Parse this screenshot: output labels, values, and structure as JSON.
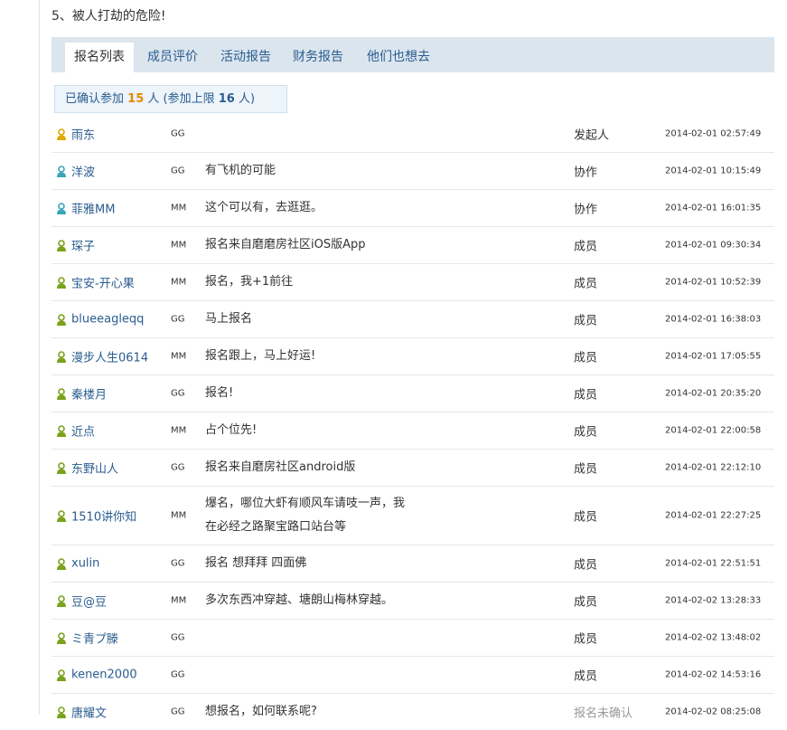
{
  "notice": "5、被人打劫的危险!",
  "tabs": [
    "报名列表",
    "成员评价",
    "活动报告",
    "财务报告",
    "他们也想去"
  ],
  "summary": {
    "prefix": "已确认参加",
    "confirmed": "15",
    "mid": "人 (参加上限",
    "limit": "16",
    "suffix": "人)"
  },
  "colors": {
    "organizer": "#e0a800",
    "helper": "#3aa6b8",
    "member": "#7aa21c",
    "link": "#2a5d8f"
  },
  "participants": [
    {
      "name": "雨东",
      "icon": "organizer-user-icon",
      "gender": "GG",
      "comment": "",
      "role": "发起人",
      "time": "2014-02-01 02:57:49"
    },
    {
      "name": "洋波",
      "icon": "helper-user-icon",
      "gender": "GG",
      "comment": "有飞机的可能",
      "role": "协作",
      "time": "2014-02-01 10:15:49"
    },
    {
      "name": "菲雅MM",
      "icon": "helper-user-icon",
      "gender": "MM",
      "comment": "这个可以有，去逛逛。",
      "role": "协作",
      "time": "2014-02-01 16:01:35"
    },
    {
      "name": "琛子",
      "icon": "member-user-icon",
      "gender": "MM",
      "comment": "报名来自磨磨房社区iOS版App",
      "role": "成员",
      "time": "2014-02-01 09:30:34"
    },
    {
      "name": "宝安-开心果",
      "icon": "member-user-icon",
      "gender": "MM",
      "comment": "报名，我+1前往",
      "role": "成员",
      "time": "2014-02-01 10:52:39"
    },
    {
      "name": "blueeagleqq",
      "icon": "member-user-icon",
      "gender": "GG",
      "comment": "马上报名",
      "role": "成员",
      "time": "2014-02-01 16:38:03"
    },
    {
      "name": "漫步人生0614",
      "icon": "member-user-icon",
      "gender": "MM",
      "comment": "报名跟上，马上好运!",
      "role": "成员",
      "time": "2014-02-01 17:05:55"
    },
    {
      "name": "秦楼月",
      "icon": "member-user-icon",
      "gender": "GG",
      "comment": "报名!",
      "role": "成员",
      "time": "2014-02-01 20:35:20"
    },
    {
      "name": "近点",
      "icon": "member-user-icon",
      "gender": "MM",
      "comment": "占个位先!",
      "role": "成员",
      "time": "2014-02-01 22:00:58"
    },
    {
      "name": "东野山人",
      "icon": "member-user-icon",
      "gender": "GG",
      "comment": "报名来自磨房社区android版",
      "role": "成员",
      "time": "2014-02-01 22:12:10"
    },
    {
      "name": "1510讲你知",
      "icon": "member-user-icon",
      "gender": "MM",
      "comment": "爆名，哪位大虾有顺风车请吱一声，我在必经之路聚宝路口站台等",
      "role": "成员",
      "time": "2014-02-01 22:27:25"
    },
    {
      "name": "xulin",
      "icon": "member-user-icon",
      "gender": "GG",
      "comment": "报名 想拜拜 四面佛",
      "role": "成员",
      "time": "2014-02-01 22:51:51"
    },
    {
      "name": "豆@豆",
      "icon": "member-user-icon",
      "gender": "MM",
      "comment": "多次东西冲穿越、塘朗山梅林穿越。",
      "role": "成员",
      "time": "2014-02-02 13:28:33"
    },
    {
      "name": "ミ青プ滕",
      "icon": "member-user-icon",
      "gender": "GG",
      "comment": "",
      "role": "成员",
      "time": "2014-02-02 13:48:02"
    },
    {
      "name": "kenen2000",
      "icon": "member-user-icon",
      "gender": "GG",
      "comment": "",
      "role": "成员",
      "time": "2014-02-02 14:53:16"
    },
    {
      "name": "唐耀文",
      "icon": "member-user-icon",
      "gender": "GG",
      "comment": "想报名，如何联系呢?",
      "role": "报名未确认",
      "time": "2014-02-02 08:25:08"
    }
  ]
}
